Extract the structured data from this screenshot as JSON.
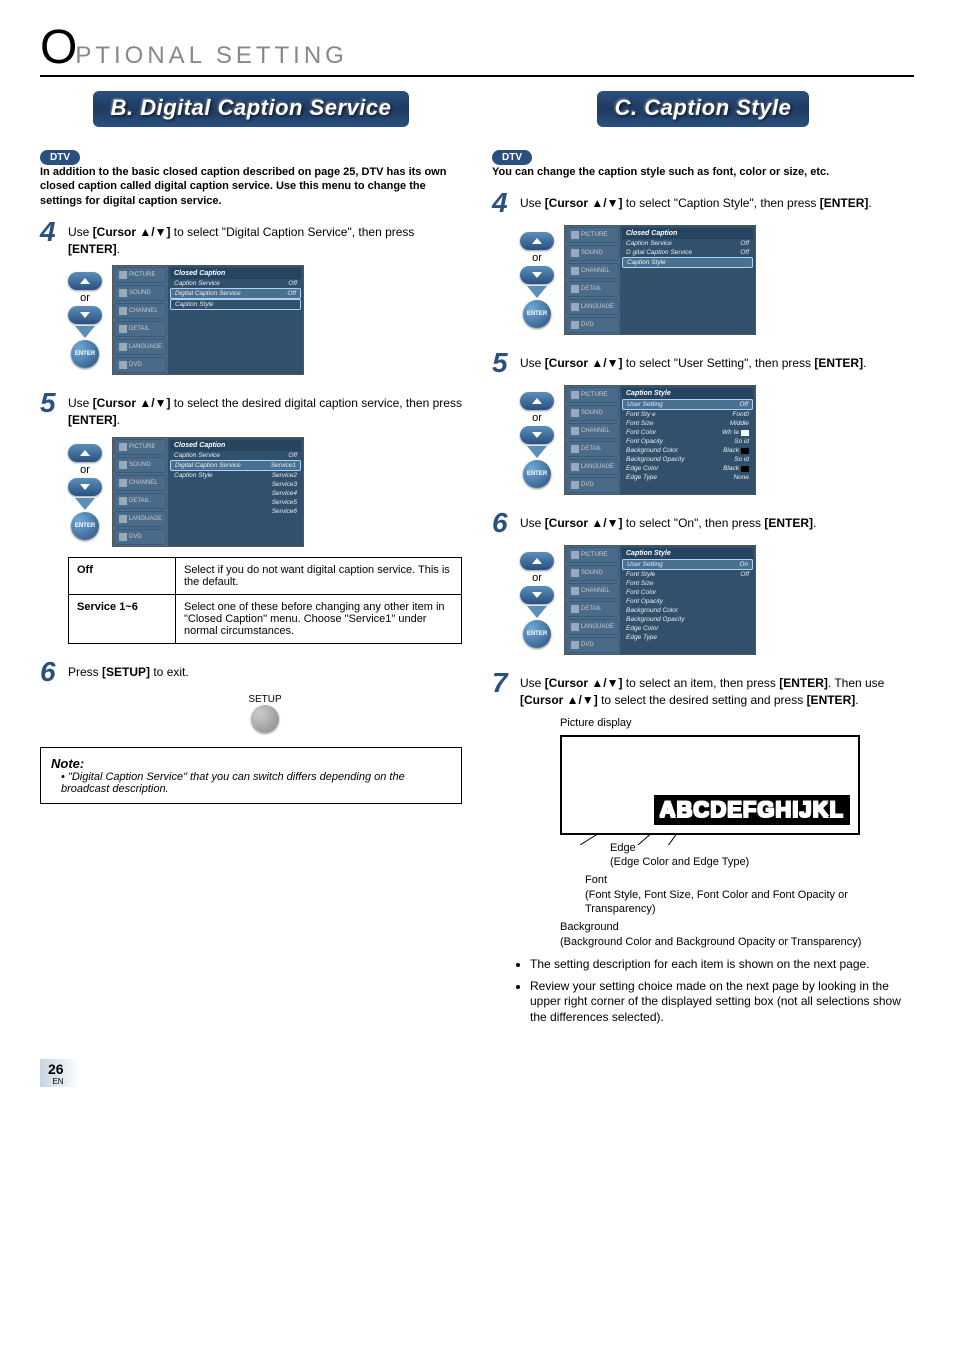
{
  "header": {
    "first": "O",
    "rest": "PTIONAL SETTING"
  },
  "sectionB": {
    "title": "B. Digital Caption Service"
  },
  "sectionC": {
    "title": "C. Caption Style"
  },
  "badge": {
    "dtv": "DTV"
  },
  "introB": "In addition to the basic closed caption described on page 25, DTV has its own closed caption called digital caption service. Use this menu to change the settings for digital caption service.",
  "introC": "You can change the caption style such as font, color or size, etc.",
  "steps": {
    "b4": {
      "num": "4",
      "pre": "Use ",
      "key": "[Cursor ▲/▼]",
      "mid": " to select \"Digital Caption Service\", then press ",
      "key2": "[ENTER]",
      "post": "."
    },
    "b5": {
      "num": "5",
      "pre": "Use ",
      "key": "[Cursor ▲/▼]",
      "mid": " to select the desired digital caption service, then press ",
      "key2": "[ENTER]",
      "post": "."
    },
    "b6": {
      "num": "6",
      "pre": "Press ",
      "key": "[SETUP]",
      "post": " to exit."
    },
    "c4": {
      "num": "4",
      "pre": "Use ",
      "key": "[Cursor ▲/▼]",
      "mid": " to select \"Caption Style\", then press ",
      "key2": "[ENTER]",
      "post": "."
    },
    "c5": {
      "num": "5",
      "pre": "Use ",
      "key": "[Cursor ▲/▼]",
      "mid": " to select \"User Setting\", then press ",
      "key2": "[ENTER]",
      "post": "."
    },
    "c6": {
      "num": "6",
      "pre": "Use ",
      "key": "[Cursor ▲/▼]",
      "mid": " to select \"On\", then press ",
      "key2": "[ENTER]",
      "post": "."
    },
    "c7": {
      "num": "7",
      "pre": "Use ",
      "key": "[Cursor ▲/▼]",
      "mid": " to select an item, then press ",
      "key2": "[ENTER]",
      "mid2": ". Then use ",
      "key3": "[Cursor ▲/▼]",
      "mid3": " to select the desired setting and press ",
      "key4": "[ENTER]",
      "post": "."
    }
  },
  "or": "or",
  "enter": "ENTER",
  "setup": "SETUP",
  "sidebar": {
    "items": [
      "PICTURE",
      "SOUND",
      "CHANNEL",
      "DETAIL",
      "LANGUAGE",
      "DVD"
    ]
  },
  "menu": {
    "closedCaption": "Closed Caption",
    "captionStyle": "Caption Style",
    "rows1": [
      {
        "l": "Caption Service",
        "r": "Off"
      },
      {
        "l": "Digital Caption Service",
        "r": "Off"
      },
      {
        "l": "Caption Style",
        "r": ""
      }
    ],
    "rows2": [
      {
        "l": "Caption Service",
        "r": "Off"
      },
      {
        "l": "Digital Caption Service",
        "r": "Service1"
      },
      {
        "l": "Caption Style",
        "r": "Service2"
      },
      {
        "l": "",
        "r": "Service3"
      },
      {
        "l": "",
        "r": "Service4"
      },
      {
        "l": "",
        "r": "Service5"
      },
      {
        "l": "",
        "r": "Service6"
      }
    ],
    "rowsC4": [
      {
        "l": "Caption Service",
        "r": "Off"
      },
      {
        "l": "D gital Caption Service",
        "r": "Off"
      },
      {
        "l": "Caption Style",
        "r": ""
      }
    ],
    "rowsC5": [
      {
        "l": "User Setting",
        "r": "Off"
      },
      {
        "l": "Font Sty e",
        "r": "Font0"
      },
      {
        "l": "Font Size",
        "r": "Middle"
      },
      {
        "l": "Font Color",
        "r": "Wh te",
        "swatch": "#fff"
      },
      {
        "l": "Font Opacity",
        "r": "So id"
      },
      {
        "l": "Background Color",
        "r": "Black",
        "swatch": "#000"
      },
      {
        "l": "Background Opacity",
        "r": "So id"
      },
      {
        "l": "Edge Color",
        "r": "Black",
        "swatch": "#000"
      },
      {
        "l": "Edge Type",
        "r": "None"
      }
    ],
    "rowsC6": [
      {
        "l": "User Setting",
        "r": "On"
      },
      {
        "l": "Font Style",
        "r": "Off"
      },
      {
        "l": "Font Size",
        "r": ""
      },
      {
        "l": "Font Color",
        "r": ""
      },
      {
        "l": "Font Opacity",
        "r": ""
      },
      {
        "l": "Background Color",
        "r": ""
      },
      {
        "l": "Background Opacity",
        "r": ""
      },
      {
        "l": "Edge Color",
        "r": ""
      },
      {
        "l": "Edge Type",
        "r": ""
      }
    ]
  },
  "optionTable": [
    {
      "l": "Off",
      "r": "Select if you do not want digital caption service. This is the default."
    },
    {
      "l": "Service 1~6",
      "r": "Select one of these before changing any other item in \"Closed Caption\" menu. Choose \"Service1\" under normal circumstances."
    }
  ],
  "note": {
    "title": "Note:",
    "bullet": "• ",
    "text": "\"Digital Caption Service\" that you can switch differs depending on the broadcast description."
  },
  "pictureDisplay": {
    "label": "Picture display",
    "sample": "ABCDEFGHIJKL"
  },
  "legend": {
    "edge": {
      "t": "Edge",
      "d": "(Edge Color and Edge Type)"
    },
    "font": {
      "t": "Font",
      "d": "(Font Style, Font Size, Font Color and Font Opacity or Transparency)"
    },
    "bg": {
      "t": "Background",
      "d": "(Background Color and Background Opacity or Transparency)"
    }
  },
  "bullets": [
    "The setting description for each item is shown on the next page.",
    "Review your setting choice made on the next page by looking in the upper right corner of the displayed setting box (not all selections show the differences selected)."
  ],
  "page": {
    "num": "26",
    "en": "EN"
  }
}
